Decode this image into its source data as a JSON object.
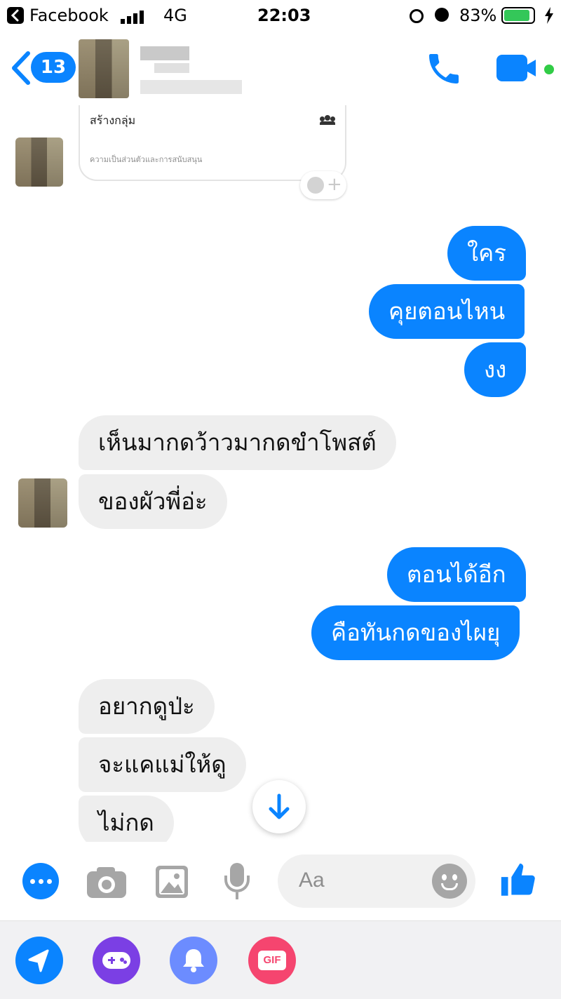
{
  "status_bar": {
    "back_app": "Facebook",
    "network": "4G",
    "time": "22:03",
    "battery": "83%"
  },
  "header": {
    "unread_count": "13"
  },
  "shared_card": {
    "title": "สร้างกลุ่ม",
    "subtitle": "ความเป็นส่วนตัวและการสนับสนุน"
  },
  "messages": [
    {
      "side": "out",
      "text": "ใคร"
    },
    {
      "side": "out",
      "text": "คุยตอนไหน"
    },
    {
      "side": "out",
      "text": "งง"
    },
    {
      "side": "in",
      "text": "เห็นมากดว้าวมากดขำโพสต์"
    },
    {
      "side": "in",
      "text": "ของผัวพี่อ่ะ"
    },
    {
      "side": "out",
      "text": "ตอนได้อีก"
    },
    {
      "side": "out",
      "text": "คือทันกดของไผยุ"
    },
    {
      "side": "in",
      "text": "อยากดูป่ะ"
    },
    {
      "side": "in",
      "text": "จะแคแม่ให้ดู"
    },
    {
      "side": "in",
      "text": "ไม่กด"
    }
  ],
  "composer": {
    "placeholder": "Aa"
  },
  "tray": {
    "gif_label": "GIF"
  },
  "colors": {
    "accent": "#0A84FF",
    "incoming_bubble": "#EEEEEE",
    "online_dot": "#31CC46",
    "game_purple": "#7B3FE4",
    "bell_blue": "#6C8CFF",
    "gif_pink": "#F5456F"
  }
}
